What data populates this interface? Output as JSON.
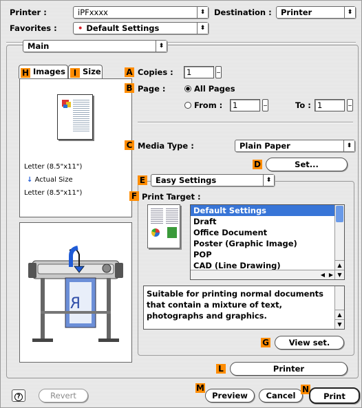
{
  "header": {
    "printer_label": "Printer :",
    "printer_value": "iPFxxxx",
    "destination_label": "Destination :",
    "destination_value": "Printer",
    "favorites_label": "Favorites :",
    "favorites_value": "Default Settings",
    "panel_value": "Main"
  },
  "tabs": [
    {
      "badge": "H",
      "label": "Images"
    },
    {
      "badge": "I",
      "label": "Size"
    }
  ],
  "preview": {
    "paper_size": "Letter (8.5\"x11\")",
    "scale_label": "Actual Size",
    "output_size": "Letter (8.5\"x11\")"
  },
  "copies": {
    "badge": "A",
    "label": "Copies :",
    "value": "1"
  },
  "page": {
    "badge": "B",
    "label": "Page :",
    "all_pages": "All Pages",
    "from_label": "From :",
    "from_value": "1",
    "to_label": "To :",
    "to_value": "1"
  },
  "media": {
    "badge": "C",
    "label": "Media Type :",
    "value": "Plain Paper",
    "set_badge": "D",
    "set_button": "Set..."
  },
  "easy": {
    "badge": "E",
    "mode": "Easy Settings",
    "target_badge": "F",
    "target_label": "Print Target :",
    "targets": [
      "Default Settings",
      "Draft",
      "Office Document",
      "Poster (Graphic Image)",
      "POP",
      "CAD (Line Drawing)"
    ],
    "selected_index": 0,
    "description": "Suitable for printing normal documents that contain a mixture of text, photographs and graphics.",
    "view_badge": "G",
    "view_button": "View set."
  },
  "printer_button": {
    "badge": "L",
    "label": "Printer"
  },
  "footer": {
    "help_icon": "?",
    "revert": "Revert",
    "preview_badge": "M",
    "preview": "Preview",
    "cancel": "Cancel",
    "print_badge": "N",
    "print": "Print"
  },
  "icons": {
    "arrows": "⬍",
    "scale_arrow": "↓"
  },
  "colors": {
    "badge": "#ff8c00",
    "selection": "#3875d7"
  }
}
